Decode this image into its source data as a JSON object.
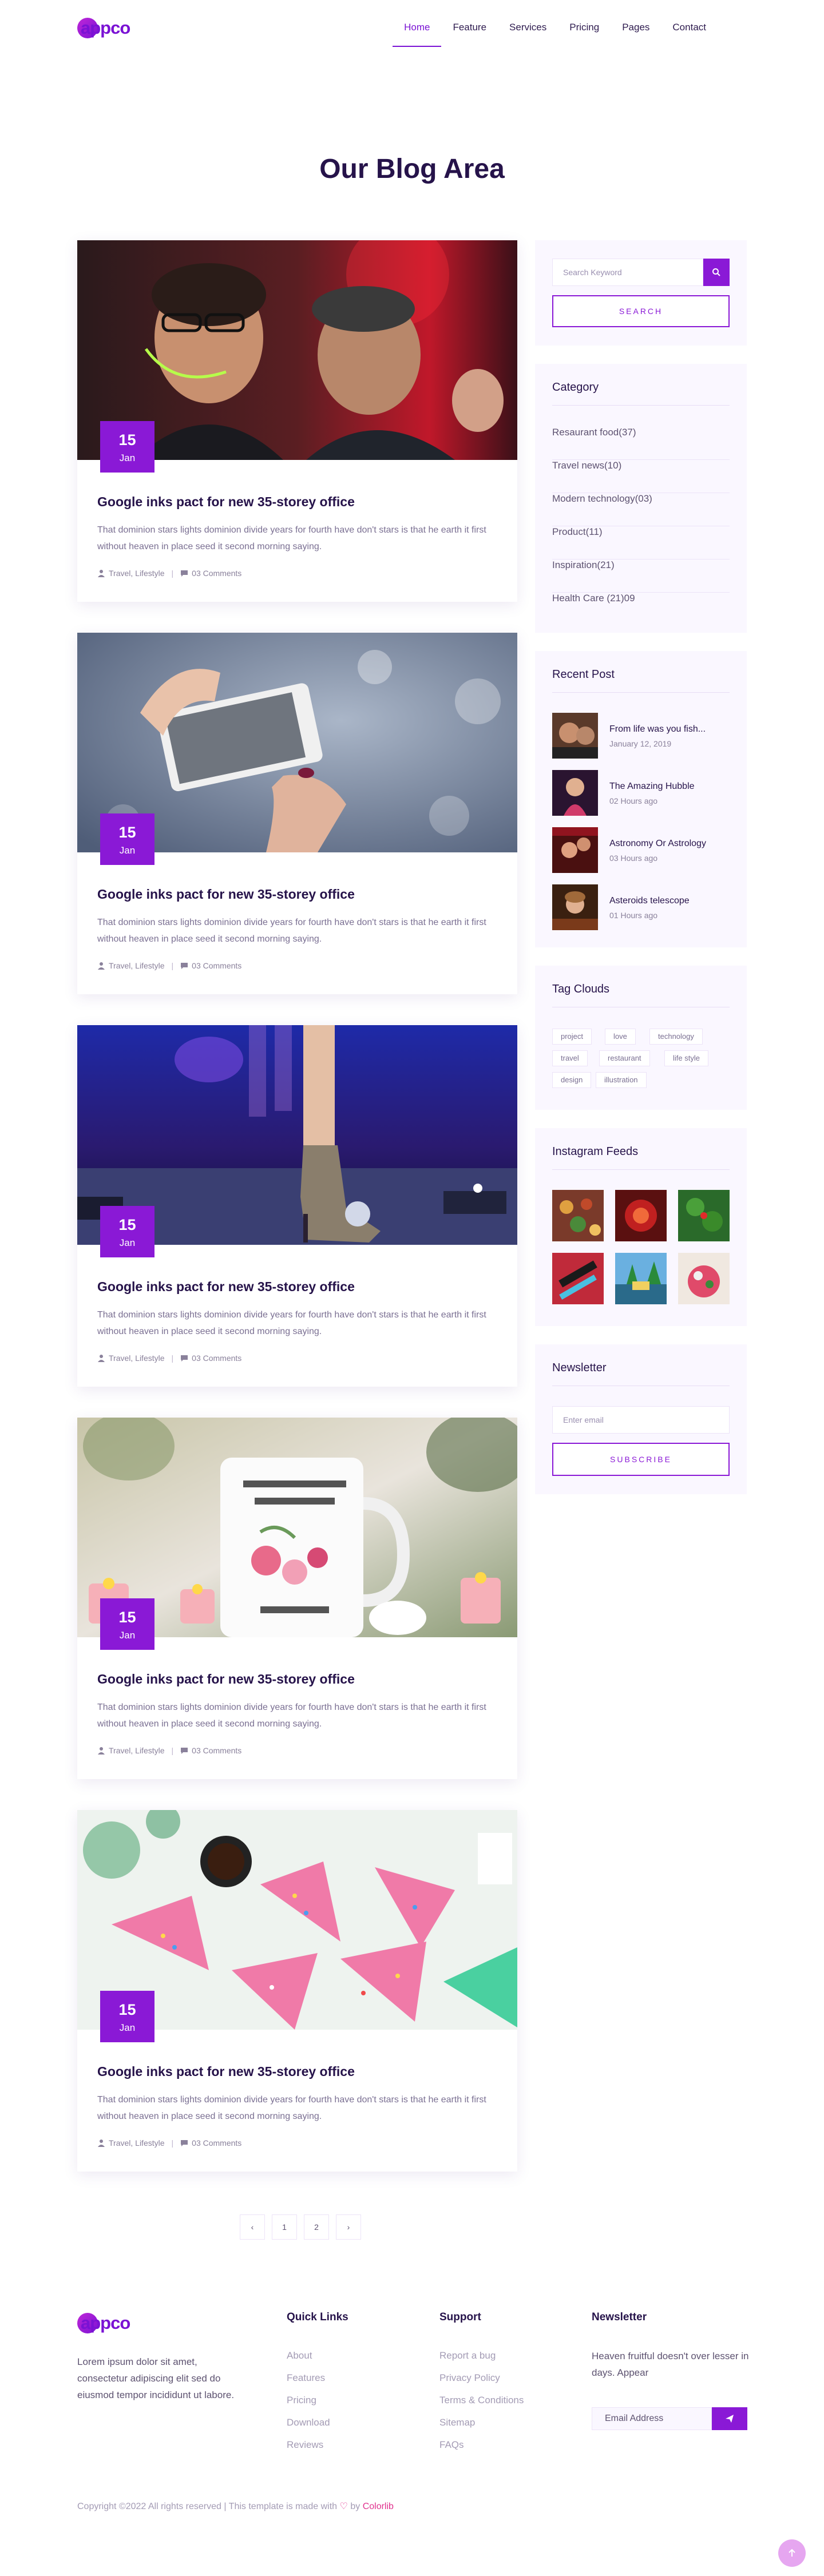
{
  "header": {
    "logo_text": "appco",
    "nav": [
      "Home",
      "Feature",
      "Services",
      "Pricing",
      "Pages",
      "Contact"
    ],
    "active_nav": "Home"
  },
  "page_title": "Our Blog Area",
  "posts": [
    {
      "day": "15",
      "month": "Jan",
      "title": "Google inks pact for new 35-storey office",
      "excerpt": "That dominion stars lights dominion divide years for fourth have don't stars is that he earth it first without heaven in place seed it second morning saying.",
      "tags": "Travel, Lifestyle",
      "comments": "03 Comments",
      "image": "party-photo"
    },
    {
      "day": "15",
      "month": "Jan",
      "title": "Google inks pact for new 35-storey office",
      "excerpt": "That dominion stars lights dominion divide years for fourth have don't stars is that he earth it first without heaven in place seed it second morning saying.",
      "tags": "Travel, Lifestyle",
      "comments": "03 Comments",
      "image": "phone-photo"
    },
    {
      "day": "15",
      "month": "Jan",
      "title": "Google inks pact for new 35-storey office",
      "excerpt": "That dominion stars lights dominion divide years for fourth have don't stars is that he earth it first without heaven in place seed it second morning saying.",
      "tags": "Travel, Lifestyle",
      "comments": "03 Comments",
      "image": "stage-boot-photo"
    },
    {
      "day": "15",
      "month": "Jan",
      "title": "Google inks pact for new 35-storey office",
      "excerpt": "That dominion stars lights dominion divide years for fourth have don't stars is that he earth it first without heaven in place seed it second morning saying.",
      "tags": "Travel, Lifestyle",
      "comments": "03 Comments",
      "image": "mug-photo"
    },
    {
      "day": "15",
      "month": "Jan",
      "title": "Google inks pact for new 35-storey office",
      "excerpt": "That dominion stars lights dominion divide years for fourth have don't stars is that he earth it first without heaven in place seed it second morning saying.",
      "tags": "Travel, Lifestyle",
      "comments": "03 Comments",
      "image": "cake-photo"
    }
  ],
  "sidebar": {
    "search": {
      "placeholder": "Search Keyword",
      "button": "SEARCH"
    },
    "category": {
      "title": "Category",
      "items": [
        "Resaurant food(37)",
        "Travel news(10)",
        "Modern technology(03)",
        "Product(11)",
        "Inspiration(21)",
        "Health Care (21)09"
      ]
    },
    "recent_post": {
      "title": "Recent Post",
      "items": [
        {
          "title": "From life was you fish...",
          "date": "January 12, 2019"
        },
        {
          "title": "The Amazing Hubble",
          "date": "02 Hours ago"
        },
        {
          "title": "Astronomy Or Astrology",
          "date": "03 Hours ago"
        },
        {
          "title": "Asteroids telescope",
          "date": "01 Hours ago"
        }
      ]
    },
    "tag_clouds": {
      "title": "Tag Clouds",
      "tags": [
        "project",
        "love",
        "technology",
        "travel",
        "restaurant",
        "life style",
        "design",
        "illustration"
      ]
    },
    "instagram": {
      "title": "Instagram Feeds"
    },
    "newsletter": {
      "title": "Newsletter",
      "placeholder": "Enter email",
      "button": "SUBSCRIBE"
    }
  },
  "pagination": {
    "items": [
      "‹",
      "1",
      "2",
      "›"
    ]
  },
  "footer": {
    "logo_text": "appco",
    "about": "Lorem ipsum dolor sit amet, consectetur adipiscing elit sed do eiusmod tempor incididunt ut labore.",
    "quick_links": {
      "title": "Quick Links",
      "items": [
        "About",
        "Features",
        "Pricing",
        "Download",
        "Reviews"
      ]
    },
    "support": {
      "title": "Support",
      "items": [
        "Report a bug",
        "Privacy Policy",
        "Terms & Conditions",
        "Sitemap",
        "FAQs"
      ]
    },
    "newsletter": {
      "title": "Newsletter",
      "text": "Heaven fruitful doesn't over lesser in days. Appear",
      "placeholder": "Email Address"
    },
    "copyright": "Copyright ©2022 All rights reserved | This template is made with",
    "copyright_by": "by",
    "brand": "Colorlib"
  },
  "colors": {
    "accent": "#8a19d6",
    "title": "#26134a",
    "sidebar_bg": "#faf7ff"
  }
}
